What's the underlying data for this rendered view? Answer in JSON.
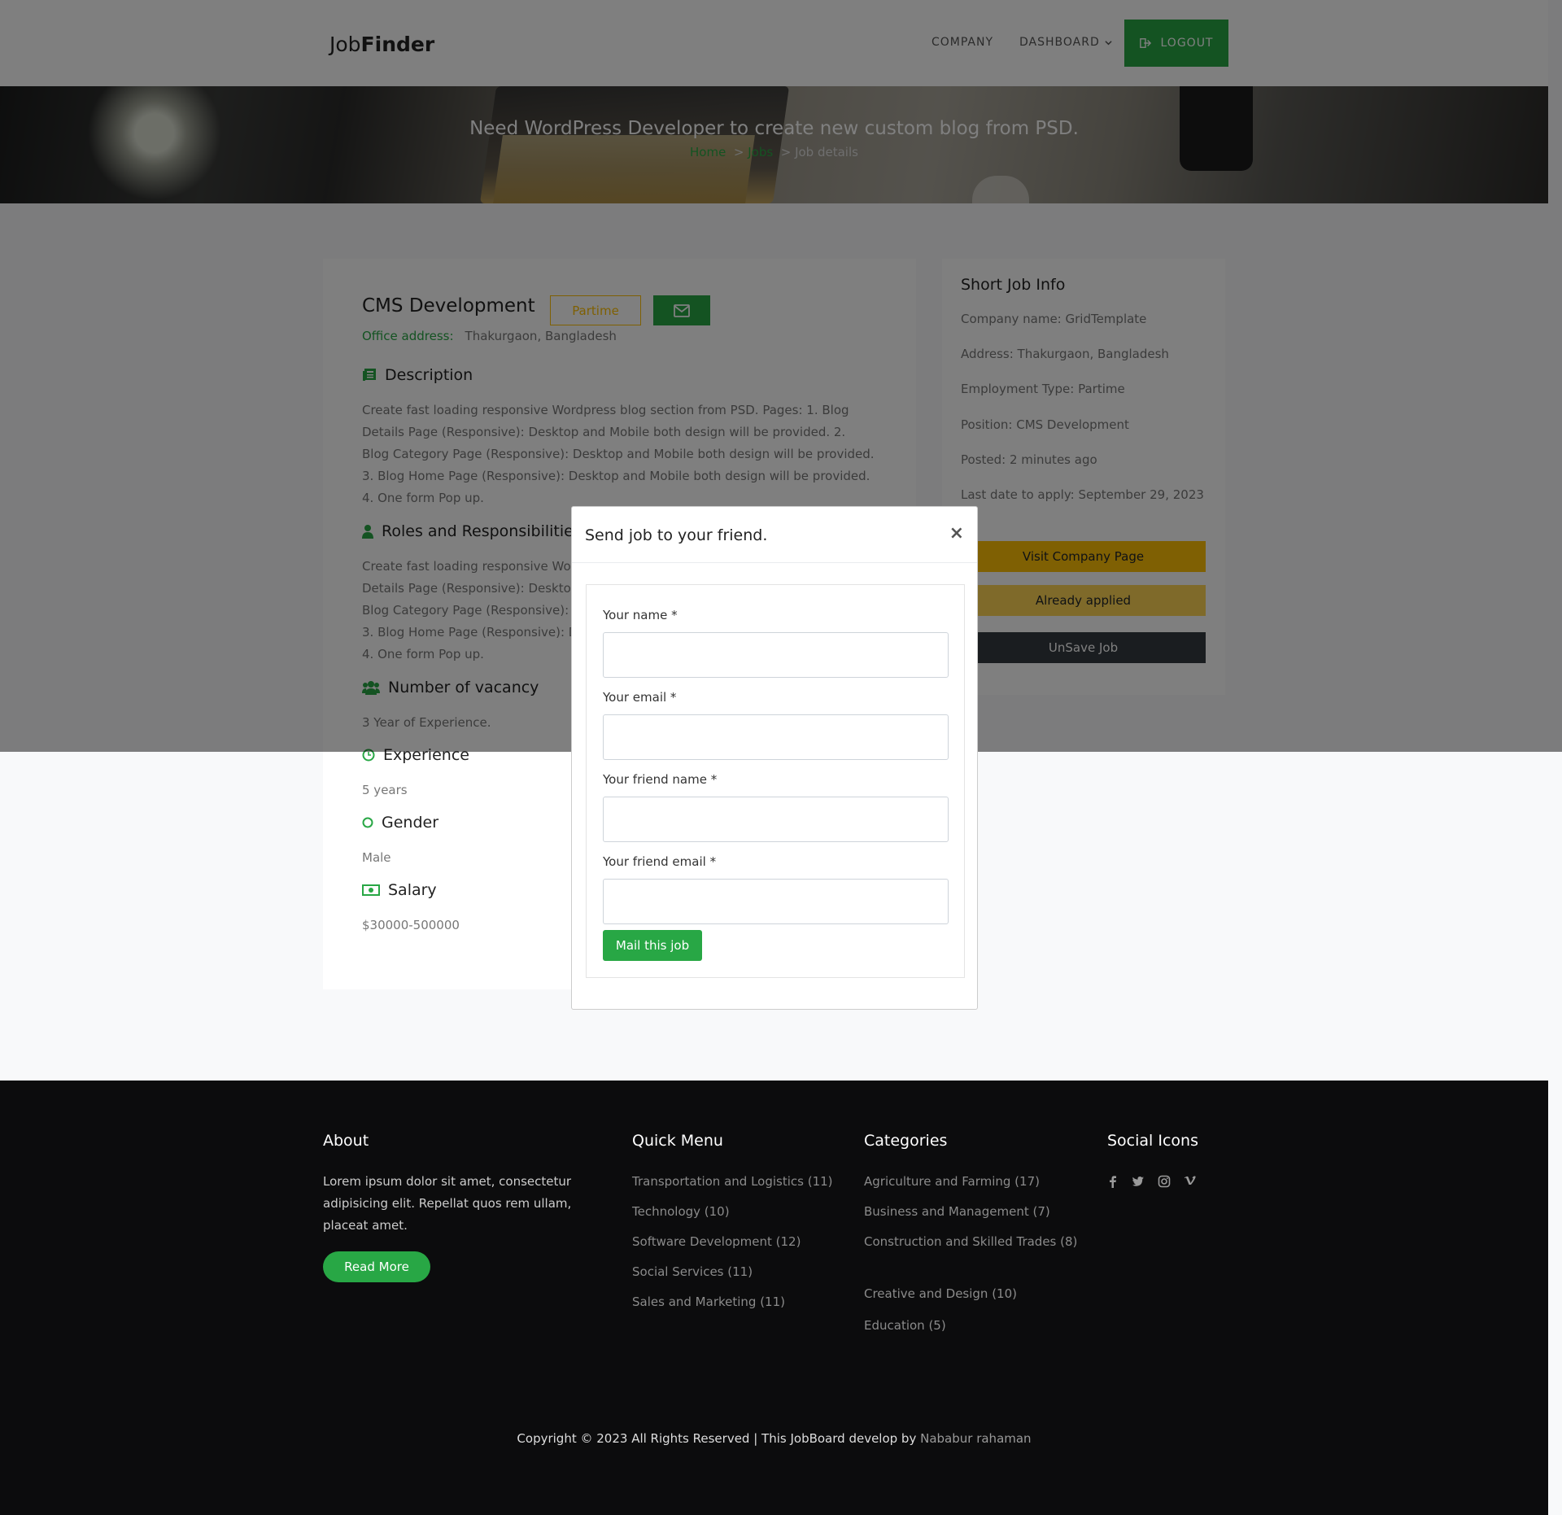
{
  "header": {
    "logo_light": "Job",
    "logo_bold": "Finder",
    "nav_company": "COMPANY",
    "nav_dashboard": "DASHBOARD",
    "logout": "LOGOUT"
  },
  "banner": {
    "title": "Need WordPress Developer to create new custom blog from PSD.",
    "crumb_home": "Home",
    "crumb_sep": ">",
    "crumb_jobs": "Jobs",
    "crumb_current": "Job details"
  },
  "job": {
    "title": "CMS Development",
    "type_badge": "Partime",
    "office_label": "Office address:",
    "office_value": "Thakurgaon, Bangladesh",
    "description_heading": "Description",
    "description_text": "Create fast loading responsive Wordpress blog section from PSD. Pages: 1. Blog Details Page (Responsive): Desktop and Mobile both design will be provided. 2. Blog Category Page (Responsive): Desktop and Mobile both design will be provided. 3. Blog Home Page (Responsive): Desktop and Mobile both design will be provided. 4. One form Pop up.",
    "roles_heading": "Roles and Responsibilities",
    "roles_text": "Create fast loading responsive Wordpress blog section from PSD. Pages: 1. Blog Details Page (Responsive): Desktop and Mobile both design will be provided. 2. Blog Category Page (Responsive): Desktop and Mobile both design will be provided. 3. Blog Home Page (Responsive): Desktop and Mobile both design will be provided. 4. One form Pop up.",
    "vacancy_heading": "Number of vacancy",
    "vacancy_text": "3 Year of Experience.",
    "experience_heading": "Experience",
    "experience_text": "5 years",
    "gender_heading": "Gender",
    "gender_text": "Male",
    "salary_heading": "Salary",
    "salary_text": "$30000-500000"
  },
  "short_info": {
    "heading": "Short Job Info",
    "company": "Company name: GridTemplate",
    "address": "Address: Thakurgaon, Bangladesh",
    "employment": "Employment Type: Partime",
    "position": "Position: CMS Development",
    "posted": "Posted: 2 minutes ago",
    "last_date": "Last date to apply: September 29, 2023",
    "visit_button": "Visit Company Page",
    "applied_button": "Already applied",
    "unsave_button": "UnSave Job"
  },
  "modal": {
    "title": "Send job to your friend.",
    "close": "×",
    "name_label": "Your name *",
    "email_label": "Your email *",
    "friend_name_label": "Your friend name *",
    "friend_email_label": "Your friend email *",
    "submit": "Mail this job"
  },
  "footer": {
    "about_heading": "About",
    "about_text": "Lorem ipsum dolor sit amet, consectetur adipisicing elit. Repellat quos rem ullam, placeat amet.",
    "read_more": "Read More",
    "quick_heading": "Quick Menu",
    "quick_items": [
      "Transportation and Logistics (11)",
      "Technology (10)",
      "Software Development (12)",
      "Social Services (11)",
      "Sales and Marketing (11)"
    ],
    "categories_heading": "Categories",
    "category_items": [
      "Agriculture and Farming (17)",
      "Business and Management (7)",
      "Construction and Skilled Trades (8)",
      "Creative and Design (10)",
      "Education (5)"
    ],
    "social_heading": "Social Icons",
    "social_icons": [
      "facebook-icon",
      "twitter-icon",
      "instagram-icon",
      "vimeo-icon"
    ],
    "copyright_prefix": "Copyright © 2023 All Rights Reserved | This JobBoard develop by",
    "copyright_author": "Nababur rahaman"
  },
  "colors": {
    "accent_green": "#28a745",
    "warning_yellow": "#ffc107",
    "dark_button": "#343a40",
    "footer_bg": "#0c0c0d"
  }
}
